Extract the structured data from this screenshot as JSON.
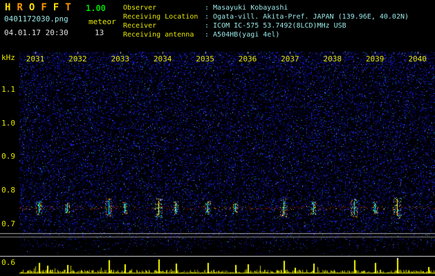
{
  "header": {
    "title_letters": [
      "H",
      "R",
      "O",
      "F",
      "F",
      "T"
    ],
    "title_colors": [
      "#ffe000",
      "#ff9800",
      "#ffe000",
      "#ff9800",
      "#ffe000",
      "#ff9800"
    ],
    "version": "1.00",
    "filename": "0401172030.png",
    "mode_label": "meteor",
    "datetime": "04.01.17 20:30",
    "meteor_count": "13",
    "info": [
      {
        "label": "Observer",
        "value": "Masayuki Kobayashi"
      },
      {
        "label": "Receiving Location",
        "value": "Ogata-vill. Akita-Pref. JAPAN (139.96E, 40.02N)"
      },
      {
        "label": "Receiver",
        "value": "ICOM IC-575 53.7492(8LCD)MHz USB"
      },
      {
        "label": "Receiving antenna",
        "value": "A504HB(yagi 4el)"
      }
    ]
  },
  "colors": {
    "background": "#000000",
    "label_yellow": "#e6e600",
    "value_cyan": "#9ae8e8",
    "version_green": "#00d800",
    "text_white": "#e0e0e0",
    "noise_blue": "#2020c0",
    "echo_red": "#c03000",
    "signal_yellow": "#ffff00"
  },
  "chart_data": {
    "type": "heatmap",
    "title": "",
    "x_ticks": [
      "2031",
      "2032",
      "2033",
      "2034",
      "2035",
      "2036",
      "2037",
      "2038",
      "2039",
      "2040"
    ],
    "y_label": "kHz",
    "y_ticks": [
      "1.1",
      "1.0",
      "0.9",
      "0.8",
      "0.7",
      "0.6"
    ],
    "y_range_khz": [
      0.6,
      1.2
    ],
    "echo_line_khz": 0.76,
    "meteor_count": 13,
    "grid": false,
    "echo_events": [
      {
        "t_min": 0.08,
        "strength": 0.55
      },
      {
        "t_min": 0.75,
        "strength": 0.35
      },
      {
        "t_min": 1.72,
        "strength": 0.8
      },
      {
        "t_min": 2.1,
        "strength": 0.4
      },
      {
        "t_min": 2.9,
        "strength": 0.85
      },
      {
        "t_min": 3.3,
        "strength": 0.45
      },
      {
        "t_min": 4.05,
        "strength": 0.5
      },
      {
        "t_min": 4.7,
        "strength": 0.35
      },
      {
        "t_min": 5.85,
        "strength": 0.75
      },
      {
        "t_min": 6.55,
        "strength": 0.45
      },
      {
        "t_min": 7.5,
        "strength": 0.8
      },
      {
        "t_min": 8.0,
        "strength": 0.5
      },
      {
        "t_min": 8.52,
        "strength": 1.0
      }
    ],
    "extra_signal_spikes": [
      {
        "t_min": 0.27,
        "height": 11
      },
      {
        "t_min": 5.0,
        "height": 13
      },
      {
        "t_min": 6.1,
        "height": 8
      },
      {
        "t_min": 9.25,
        "height": 9
      }
    ]
  }
}
